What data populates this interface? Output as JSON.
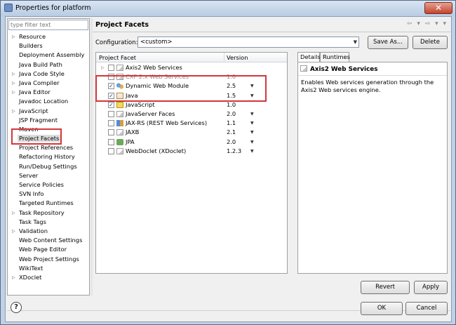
{
  "window": {
    "title": "Properties for           platform",
    "close_glyph": "✕"
  },
  "left": {
    "filter_placeholder": "type filter text",
    "items": [
      {
        "label": "Resource",
        "expandable": true
      },
      {
        "label": "Builders",
        "expandable": false
      },
      {
        "label": "Deployment Assembly",
        "expandable": false
      },
      {
        "label": "Java Build Path",
        "expandable": false
      },
      {
        "label": "Java Code Style",
        "expandable": true
      },
      {
        "label": "Java Compiler",
        "expandable": true
      },
      {
        "label": "Java Editor",
        "expandable": true
      },
      {
        "label": "Javadoc Location",
        "expandable": false
      },
      {
        "label": "JavaScript",
        "expandable": true
      },
      {
        "label": "JSP Fragment",
        "expandable": false
      },
      {
        "label": "Maven",
        "expandable": false
      },
      {
        "label": "Project Facets",
        "expandable": false,
        "selected": true
      },
      {
        "label": "Project References",
        "expandable": false
      },
      {
        "label": "Refactoring History",
        "expandable": false
      },
      {
        "label": "Run/Debug Settings",
        "expandable": false
      },
      {
        "label": "Server",
        "expandable": false
      },
      {
        "label": "Service Policies",
        "expandable": false
      },
      {
        "label": "SVN Info",
        "expandable": false
      },
      {
        "label": "Targeted Runtimes",
        "expandable": false
      },
      {
        "label": "Task Repository",
        "expandable": true
      },
      {
        "label": "Task Tags",
        "expandable": false
      },
      {
        "label": "Validation",
        "expandable": true
      },
      {
        "label": "Web Content Settings",
        "expandable": false
      },
      {
        "label": "Web Page Editor",
        "expandable": false
      },
      {
        "label": "Web Project Settings",
        "expandable": false
      },
      {
        "label": "WikiText",
        "expandable": false
      },
      {
        "label": "XDoclet",
        "expandable": true
      }
    ]
  },
  "page": {
    "title": "Project Facets",
    "nav_arrows": "⇦ ▾ ⇨ ▾ ▾",
    "configuration_label": "Configuration:",
    "configuration_value": "<custom>",
    "save_as_label": "Save As...",
    "delete_label": "Delete",
    "revert_label": "Revert",
    "apply_label": "Apply"
  },
  "facets": {
    "col_facet": "Project Facet",
    "col_version": "Version",
    "rows": [
      {
        "name": "Axis2 Web Services",
        "version": "",
        "checked": false,
        "expandable": true,
        "icon": "facet-icon",
        "grey": false,
        "dropdown": false
      },
      {
        "name": "CXF 2.x Web Services",
        "version": "1.0",
        "checked": false,
        "expandable": false,
        "icon": "facet-icon",
        "grey": true,
        "dropdown": false
      },
      {
        "name": "Dynamic Web Module",
        "version": "2.5",
        "checked": true,
        "expandable": false,
        "icon": "dynamic-web-icon",
        "grey": false,
        "dropdown": true
      },
      {
        "name": "Java",
        "version": "1.5",
        "checked": true,
        "expandable": false,
        "icon": "java-icon",
        "grey": false,
        "dropdown": true
      },
      {
        "name": "JavaScript",
        "version": "1.0",
        "checked": true,
        "expandable": false,
        "icon": "javascript-icon",
        "grey": false,
        "dropdown": false
      },
      {
        "name": "JavaServer Faces",
        "version": "2.0",
        "checked": false,
        "expandable": false,
        "icon": "facet-icon",
        "grey": false,
        "dropdown": true
      },
      {
        "name": "JAX-RS (REST Web Services)",
        "version": "1.1",
        "checked": false,
        "expandable": false,
        "icon": "jaxrs-icon",
        "grey": false,
        "dropdown": true
      },
      {
        "name": "JAXB",
        "version": "2.1",
        "checked": false,
        "expandable": false,
        "icon": "facet-icon",
        "grey": false,
        "dropdown": true
      },
      {
        "name": "JPA",
        "version": "2.0",
        "checked": false,
        "expandable": false,
        "icon": "jpa-icon",
        "grey": false,
        "dropdown": true
      },
      {
        "name": "WebDoclet (XDoclet)",
        "version": "1.2.3",
        "checked": false,
        "expandable": false,
        "icon": "facet-icon",
        "grey": false,
        "dropdown": true
      }
    ]
  },
  "details": {
    "tab_details": "Details",
    "tab_runtimes": "Runtimes",
    "title": "Axis2 Web Services",
    "description": "Enables Web services generation through the Axis2 Web services engine."
  },
  "footer": {
    "help_glyph": "?",
    "ok_label": "OK",
    "cancel_label": "Cancel"
  }
}
